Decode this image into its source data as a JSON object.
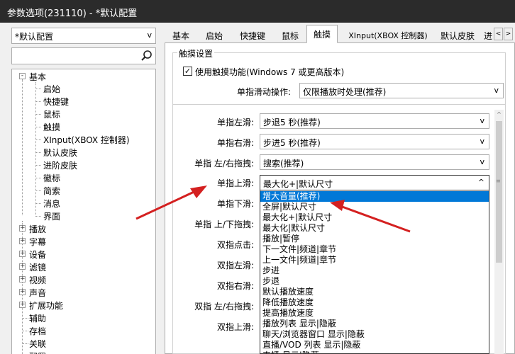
{
  "window": {
    "title": "参数选项(231110) - *默认配置"
  },
  "profile": {
    "selected": "*默认配置"
  },
  "search": {
    "value": "",
    "placeholder": ""
  },
  "tree": {
    "sections": [
      {
        "label": "基本",
        "expanded": true
      },
      {
        "label": "播放"
      },
      {
        "label": "字幕"
      },
      {
        "label": "设备"
      },
      {
        "label": "滤镜"
      },
      {
        "label": "视频"
      },
      {
        "label": "声音"
      },
      {
        "label": "扩展功能"
      }
    ],
    "children": [
      "启始",
      "快捷键",
      "鼠标",
      "触摸",
      "XInput(XBOX 控制器)",
      "默认皮肤",
      "进阶皮肤",
      "徽标",
      "简索",
      "消息",
      "界面"
    ],
    "plain": [
      "辅助",
      "存档",
      "关联",
      "配置"
    ]
  },
  "tabs": [
    "基本",
    "启始",
    "快捷键",
    "鼠标",
    "触摸",
    "XInput(XBOX 控制器)",
    "默认皮肤",
    "进"
  ],
  "active_tab": "触摸",
  "tab_scroll": {
    "left": "<",
    "right": ">"
  },
  "touch": {
    "group_title": "触摸设置",
    "enable_label": "使用触摸功能(Windows 7 或更高版本)",
    "enable_checked": "✓",
    "single_slide_label": "单指滑动操作:",
    "single_slide_value": "仅限播放时处理(推荐)",
    "rows": [
      {
        "label": "单指左滑:",
        "value": "步退5 秒(推荐)"
      },
      {
        "label": "单指右滑:",
        "value": "步进5 秒(推荐)"
      },
      {
        "label": "单指 左/右拖拽:",
        "value": "搜索(推荐)"
      },
      {
        "label": "单指上滑:",
        "value": "最大化+|默认尺寸"
      },
      {
        "label": "单指下滑:"
      },
      {
        "label": "单指 上/下拖拽:"
      },
      {
        "label": "双指点击:"
      },
      {
        "label": "双指左滑:"
      },
      {
        "label": "双指右滑:"
      },
      {
        "label": "双指 左/右拖拽:"
      },
      {
        "label": "双指上滑:"
      }
    ]
  },
  "dropdown": {
    "selected_index": 0,
    "items": [
      "增大音量(推荐)",
      "全屏|默认尺寸",
      "最大化+|默认尺寸",
      "最大化|默认尺寸",
      "播放|暂停",
      "下一文件|频道|章节",
      "上一文件|频道|章节",
      "步进",
      "步退",
      "默认播放速度",
      "降低播放速度",
      "提高播放速度",
      "播放列表 显示|隐蔽",
      "聊天/浏览器窗口 显示|隐蔽",
      "直播/VOD 列表 显示|隐蔽",
      "直播 显示|隐蔽"
    ]
  },
  "icons": {
    "search": "search-icon",
    "expand": "+",
    "collapse": "-",
    "chevron_down": "v",
    "chevron_up": "^",
    "grip": "≡"
  },
  "colors": {
    "titlebar": "#2b2b2b",
    "selection": "#0078d7",
    "annotation_arrow": "#d42020"
  }
}
